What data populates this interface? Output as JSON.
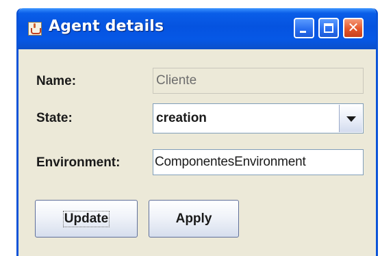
{
  "window": {
    "title": "Agent details",
    "icon": "java-cup-icon",
    "controls": [
      "minimize-icon",
      "maximize-icon",
      "close-icon"
    ]
  },
  "form": {
    "name_label": "Name:",
    "name_value": "Cliente",
    "state_label": "State:",
    "state_value": "creation",
    "environment_label": "Environment:",
    "environment_value": "ComponentesEnvironment"
  },
  "buttons": {
    "update_label": "Update",
    "apply_label": "Apply"
  },
  "colors": {
    "titlebar": "#0553e0",
    "window_bg": "#ece9d8",
    "close_button": "#e4562a"
  }
}
